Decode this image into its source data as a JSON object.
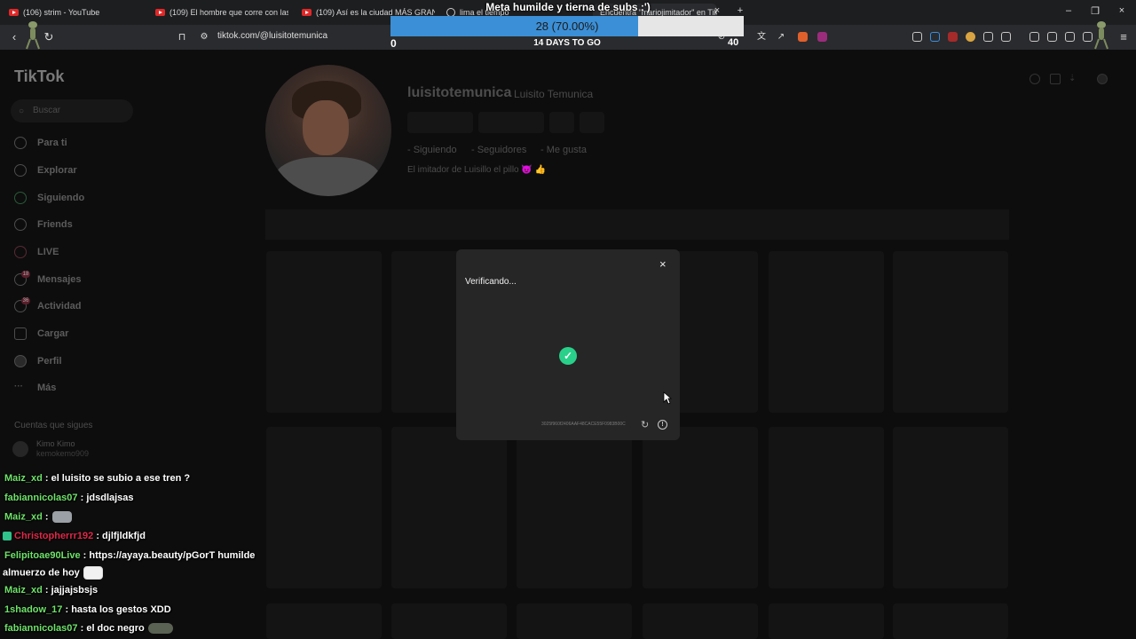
{
  "browser": {
    "tabs": [
      {
        "title": "(106) strim - YouTube",
        "icon": "youtube-icon"
      },
      {
        "title": "(109) El hombre que corre con las m",
        "icon": "youtube-icon"
      },
      {
        "title": "(109) Así es la ciudad MÁS GRANDE",
        "icon": "youtube-icon"
      },
      {
        "title": "lima el tiempo",
        "icon": "globe-icon"
      },
      {
        "title": "Encuentra \"mariojimitador\" en Tik",
        "icon": "tiktok-icon"
      }
    ],
    "url": "tiktok.com/@luisitotemunica",
    "ext_badge": "40"
  },
  "goal": {
    "title": "Meta humilde y tierna de subs :')",
    "progress_label": "28 (70.00%)",
    "progress": 0.7,
    "start": "0",
    "days_left": "14 DAYS TO GO",
    "fill_color": "#3b8fd6"
  },
  "tiktok": {
    "logo": "TikTok",
    "search_placeholder": "Buscar",
    "nav": [
      {
        "label": "Para ti",
        "icon": "home-icon"
      },
      {
        "label": "Explorar",
        "icon": "compass-icon"
      },
      {
        "label": "Siguiendo",
        "icon": "following-icon"
      },
      {
        "label": "Friends",
        "icon": "friends-icon"
      },
      {
        "label": "LIVE",
        "icon": "live-icon"
      },
      {
        "label": "Mensajes",
        "icon": "messages-icon",
        "badge": "18"
      },
      {
        "label": "Actividad",
        "icon": "activity-icon",
        "badge": "36"
      },
      {
        "label": "Cargar",
        "icon": "upload-icon"
      },
      {
        "label": "Perfil",
        "icon": "profile-icon"
      },
      {
        "label": "Más",
        "icon": "more-icon"
      }
    ],
    "following_header": "Cuentas que sigues",
    "following": [
      {
        "name": "Kimo Kimo",
        "handle": "kemokemo909"
      }
    ],
    "profile": {
      "username": "luisitotemunica",
      "display_name": "Luisito Temunica",
      "stats": [
        "- Siguiendo",
        "- Seguidores",
        "- Me gusta"
      ],
      "bio": "El imitador de Luisillo el pillo 😈 👍"
    },
    "modal": {
      "title": "Verificando...",
      "close": "×",
      "ray_id": "3025f960f2406AAF48CACE55F0983B00C",
      "check": "✓",
      "check_color": "#29d089"
    }
  },
  "chat": [
    {
      "user": "Maiz_xd",
      "color": "#6fe36a",
      "text": ": el luisito se subio a ese tren ?"
    },
    {
      "user": "fabiannicolas07",
      "color": "#6fe36a",
      "text": ": jdsdlajsas"
    },
    {
      "user": "Maiz_xd",
      "color": "#6fe36a",
      "text": ":",
      "emote": "grey"
    },
    {
      "user": "Christopherrr192",
      "color": "#e0294a",
      "text": ": djlfjldkfjd",
      "sub": true
    },
    {
      "user": "Felipitoae90Live",
      "color": "#6fe36a",
      "text": ": https://ayaya.beauty/pGorT humilde"
    },
    {
      "user": "",
      "color": "#fff",
      "text": "almuerzo de hoy",
      "emote": "pink"
    },
    {
      "user": "Maiz_xd",
      "color": "#6fe36a",
      "text": ": jajjajsbsjs"
    },
    {
      "user": "1shadow_17",
      "color": "#6fe36a",
      "text": ": hasta los gestos XDD"
    },
    {
      "user": "fabiannicolas07",
      "color": "#6fe36a",
      "text": ": el doc negro",
      "emote": "croc"
    }
  ]
}
